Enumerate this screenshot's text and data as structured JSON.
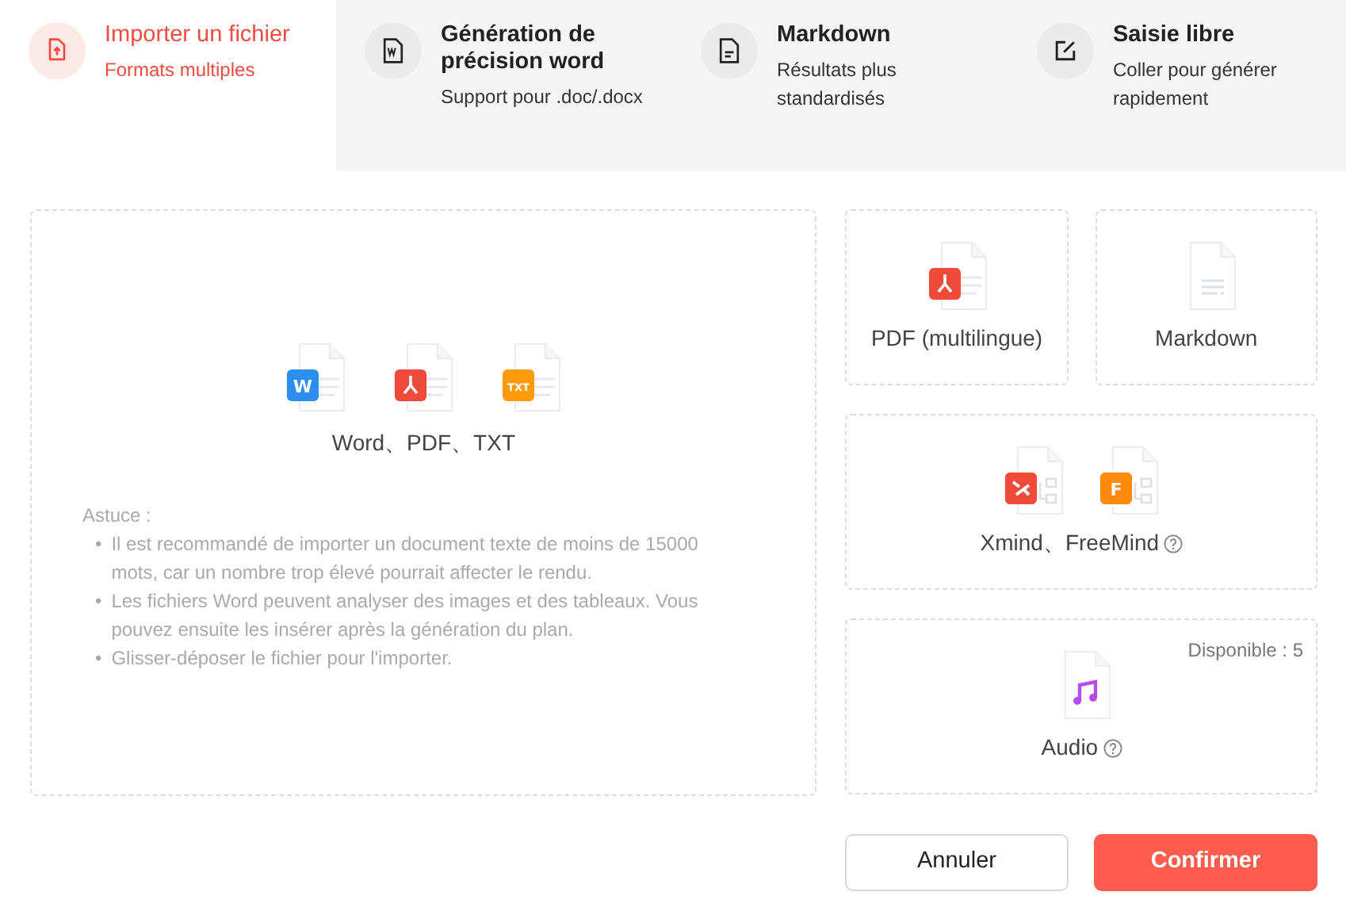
{
  "tabs": [
    {
      "kind": "upload",
      "title": "Importer un fichier",
      "subtitle": "Formats multiples",
      "selected": true
    },
    {
      "kind": "word",
      "title": "Génération de précision word",
      "subtitle": "Support pour .doc/.docx",
      "selected": false
    },
    {
      "kind": "markdown",
      "title": "Markdown",
      "subtitle": "Résultats plus standardisés",
      "selected": false
    },
    {
      "kind": "edit",
      "title": "Saisie libre",
      "subtitle": "Coller pour générer rapidement",
      "selected": false
    }
  ],
  "upload": {
    "formats": [
      {
        "kind": "word",
        "badge": "W"
      },
      {
        "kind": "pdf"
      },
      {
        "kind": "txt",
        "badge": "TXT"
      }
    ],
    "label": "Word、PDF、TXT",
    "tip_title": "Astuce :",
    "tips": [
      {
        "marker": "•",
        "text": "Il est recommandé de importer un document texte de moins de 15000 mots, car un nombre trop élevé pourrait affecter le rendu."
      },
      {
        "marker": "•",
        "text": "Les fichiers Word peuvent analyser des images et des tableaux. Vous pouvez ensuite les insérer après la génération du plan."
      },
      {
        "marker": "•",
        "text": "Glisser-déposer le fichier pour l'importer."
      }
    ]
  },
  "cards": [
    {
      "label": "PDF (multilingue)",
      "help": false,
      "icons": [
        {
          "kind": "pdf"
        }
      ]
    },
    {
      "label": "Markdown",
      "help": false,
      "icons": [
        {
          "kind": "markdown"
        }
      ]
    },
    {
      "label": "Xmind、FreeMind",
      "help": true,
      "icons": [
        {
          "kind": "xmind"
        },
        {
          "kind": "freemind",
          "badge": "F"
        }
      ]
    },
    {
      "label": "Audio",
      "help": true,
      "quota": "Disponible : 5",
      "icons": [
        {
          "kind": "audio"
        }
      ]
    }
  ],
  "buttons": [
    {
      "kind": "secondary",
      "label": "Annuler"
    },
    {
      "kind": "primary",
      "label": "Confirmer"
    }
  ]
}
